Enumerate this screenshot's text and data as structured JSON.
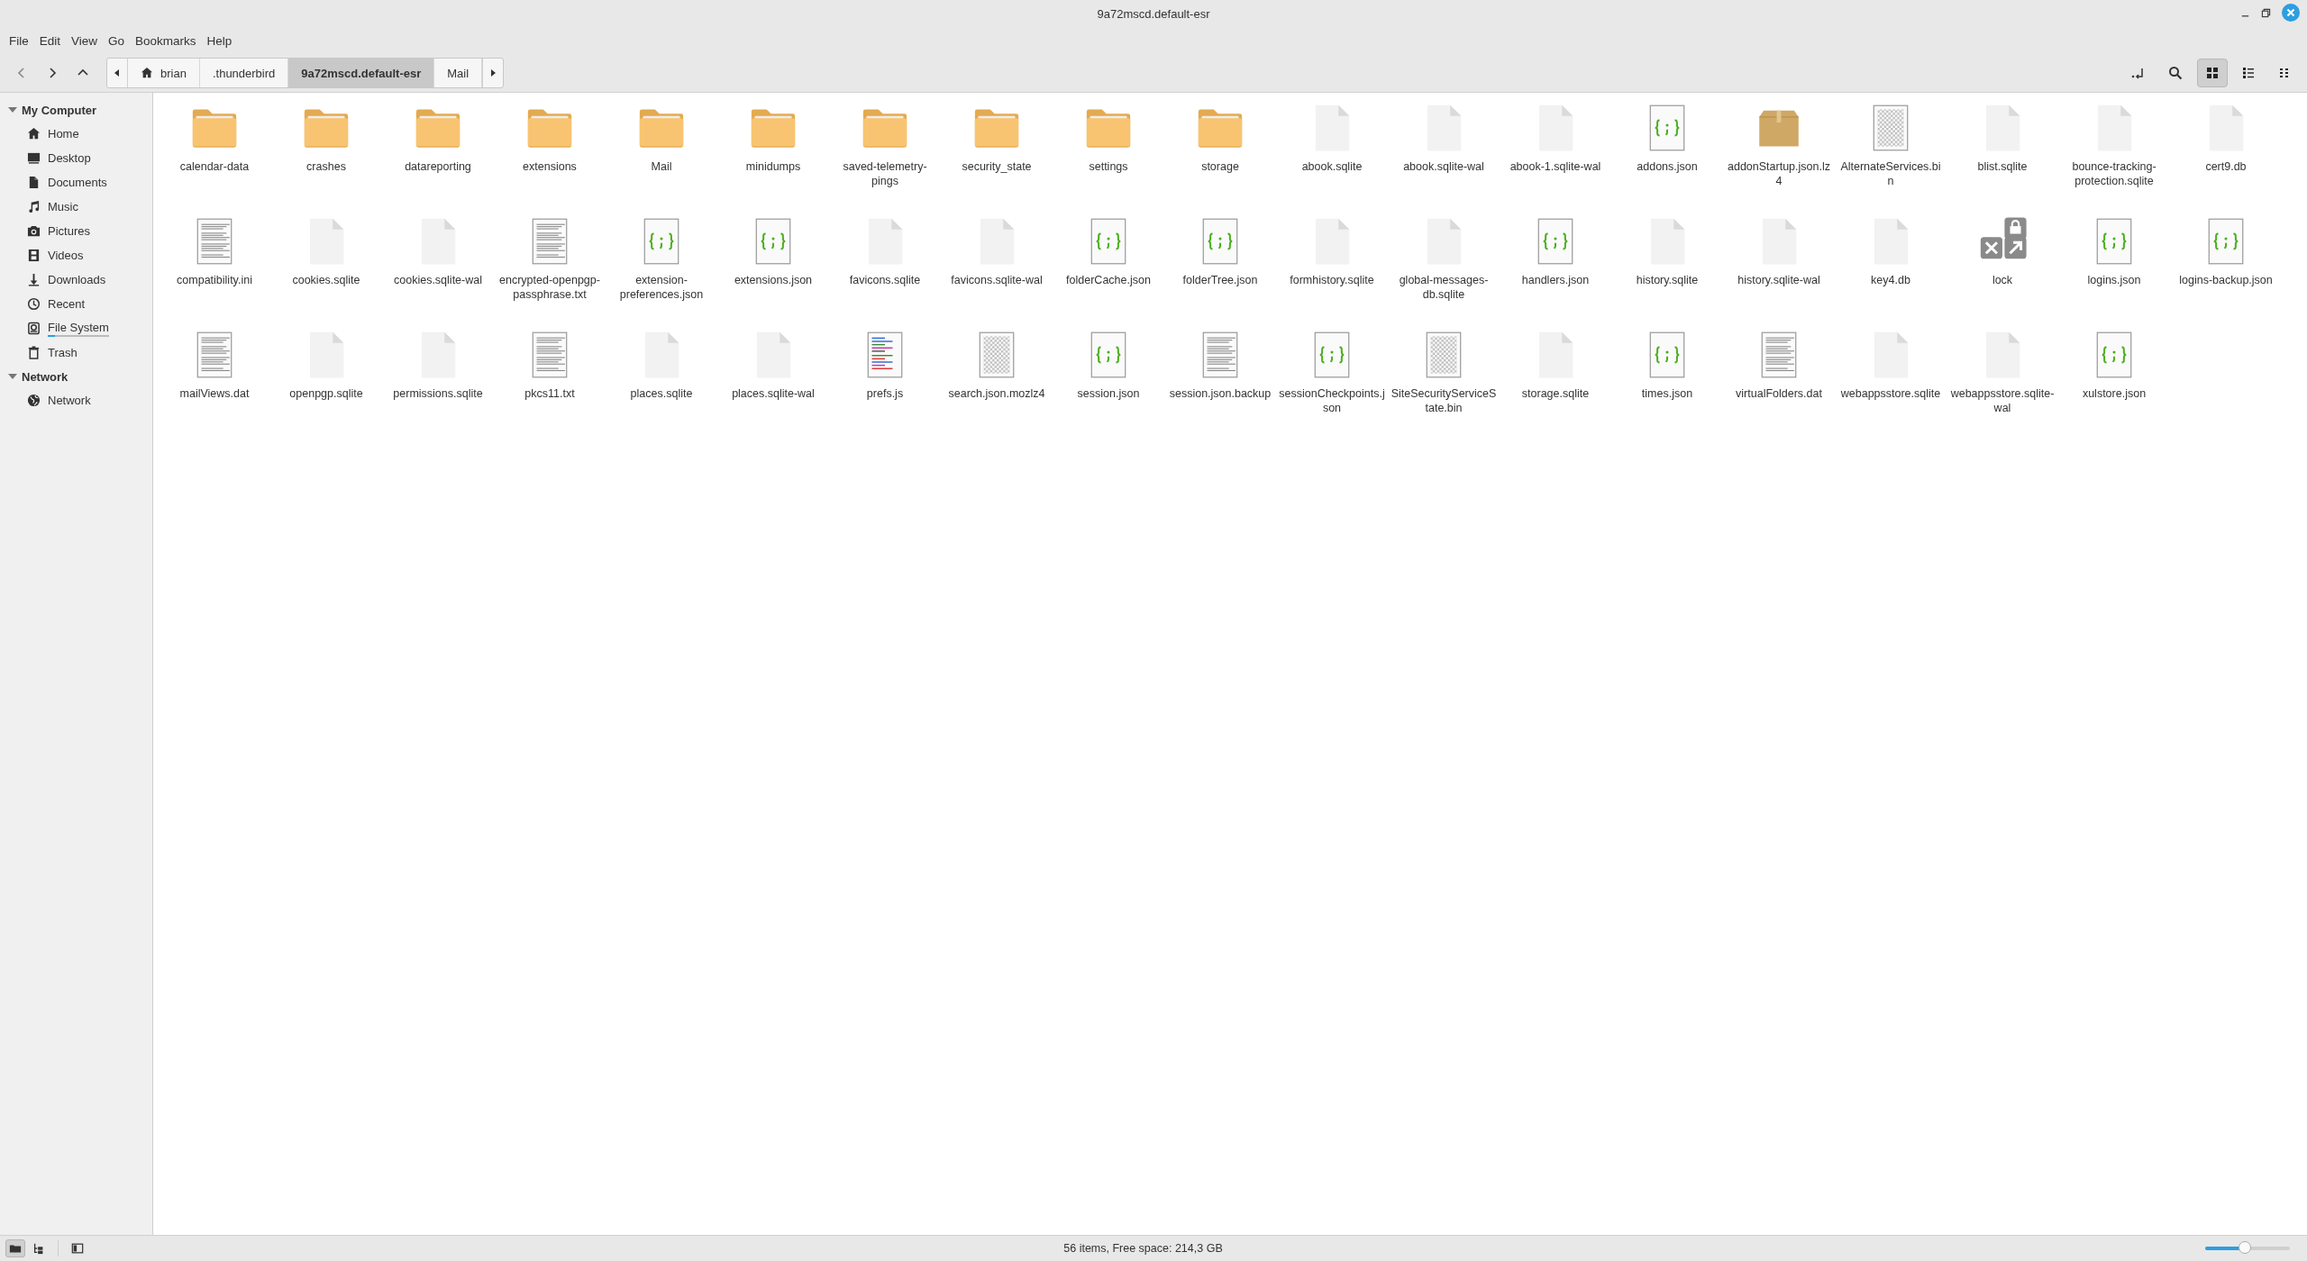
{
  "window": {
    "title": "9a72mscd.default-esr"
  },
  "menu": [
    "File",
    "Edit",
    "View",
    "Go",
    "Bookmarks",
    "Help"
  ],
  "breadcrumbs": [
    {
      "label": "brian",
      "kind": "home",
      "selected": false
    },
    {
      "label": ".thunderbird",
      "kind": "folder",
      "selected": false
    },
    {
      "label": "9a72mscd.default-esr",
      "kind": "folder",
      "selected": true
    },
    {
      "label": "Mail",
      "kind": "folder",
      "selected": false
    }
  ],
  "view_modes": [
    {
      "kind": "icons",
      "selected": true
    },
    {
      "kind": "list",
      "selected": false
    },
    {
      "kind": "compact",
      "selected": false
    }
  ],
  "sidebar": {
    "sections": [
      {
        "label": "My Computer",
        "expanded": true,
        "items": [
          {
            "label": "Home",
            "kind": "home"
          },
          {
            "label": "Desktop",
            "kind": "desktop"
          },
          {
            "label": "Documents",
            "kind": "documents"
          },
          {
            "label": "Music",
            "kind": "music"
          },
          {
            "label": "Pictures",
            "kind": "pictures"
          },
          {
            "label": "Videos",
            "kind": "videos"
          },
          {
            "label": "Downloads",
            "kind": "downloads"
          },
          {
            "label": "Recent",
            "kind": "recent"
          },
          {
            "label": "File System",
            "kind": "filesystem",
            "level": 0.12
          },
          {
            "label": "Trash",
            "kind": "trash"
          }
        ]
      },
      {
        "label": "Network",
        "expanded": true,
        "items": [
          {
            "label": "Network",
            "kind": "network"
          }
        ]
      }
    ]
  },
  "files": [
    {
      "name": "calendar-data",
      "kind": "folder"
    },
    {
      "name": "crashes",
      "kind": "folder"
    },
    {
      "name": "datareporting",
      "kind": "folder"
    },
    {
      "name": "extensions",
      "kind": "folder"
    },
    {
      "name": "Mail",
      "kind": "folder"
    },
    {
      "name": "minidumps",
      "kind": "folder"
    },
    {
      "name": "saved-telemetry-pings",
      "kind": "folder"
    },
    {
      "name": "security_state",
      "kind": "folder"
    },
    {
      "name": "settings",
      "kind": "folder"
    },
    {
      "name": "storage",
      "kind": "folder"
    },
    {
      "name": "abook.sqlite",
      "kind": "blank"
    },
    {
      "name": "abook.sqlite-wal",
      "kind": "blank"
    },
    {
      "name": "abook-1.sqlite-wal",
      "kind": "blank"
    },
    {
      "name": "addons.json",
      "kind": "json"
    },
    {
      "name": "addonStartup.json.lz4",
      "kind": "archive"
    },
    {
      "name": "AlternateServices.bin",
      "kind": "binary"
    },
    {
      "name": "blist.sqlite",
      "kind": "blank"
    },
    {
      "name": "bounce-tracking-protection.sqlite",
      "kind": "blank"
    },
    {
      "name": "cert9.db",
      "kind": "blank"
    },
    {
      "name": "compatibility.ini",
      "kind": "text"
    },
    {
      "name": "cookies.sqlite",
      "kind": "blank"
    },
    {
      "name": "cookies.sqlite-wal",
      "kind": "blank"
    },
    {
      "name": "encrypted-openpgp-passphrase.txt",
      "kind": "text"
    },
    {
      "name": "extension-preferences.json",
      "kind": "json"
    },
    {
      "name": "extensions.json",
      "kind": "json"
    },
    {
      "name": "favicons.sqlite",
      "kind": "blank"
    },
    {
      "name": "favicons.sqlite-wal",
      "kind": "blank"
    },
    {
      "name": "folderCache.json",
      "kind": "json"
    },
    {
      "name": "folderTree.json",
      "kind": "json"
    },
    {
      "name": "formhistory.sqlite",
      "kind": "blank"
    },
    {
      "name": "global-messages-db.sqlite",
      "kind": "blank"
    },
    {
      "name": "handlers.json",
      "kind": "json"
    },
    {
      "name": "history.sqlite",
      "kind": "blank"
    },
    {
      "name": "history.sqlite-wal",
      "kind": "blank"
    },
    {
      "name": "key4.db",
      "kind": "blank"
    },
    {
      "name": "lock",
      "kind": "link"
    },
    {
      "name": "logins.json",
      "kind": "json"
    },
    {
      "name": "logins-backup.json",
      "kind": "json"
    },
    {
      "name": "mailViews.dat",
      "kind": "text"
    },
    {
      "name": "openpgp.sqlite",
      "kind": "blank"
    },
    {
      "name": "permissions.sqlite",
      "kind": "blank"
    },
    {
      "name": "pkcs11.txt",
      "kind": "text"
    },
    {
      "name": "places.sqlite",
      "kind": "blank"
    },
    {
      "name": "places.sqlite-wal",
      "kind": "blank"
    },
    {
      "name": "prefs.js",
      "kind": "script"
    },
    {
      "name": "search.json.mozlz4",
      "kind": "binary"
    },
    {
      "name": "session.json",
      "kind": "json"
    },
    {
      "name": "session.json.backup",
      "kind": "text"
    },
    {
      "name": "sessionCheckpoints.json",
      "kind": "json"
    },
    {
      "name": "SiteSecurityServiceState.bin",
      "kind": "binary"
    },
    {
      "name": "storage.sqlite",
      "kind": "blank"
    },
    {
      "name": "times.json",
      "kind": "json"
    },
    {
      "name": "virtualFolders.dat",
      "kind": "text"
    },
    {
      "name": "webappsstore.sqlite",
      "kind": "blank"
    },
    {
      "name": "webappsstore.sqlite-wal",
      "kind": "blank"
    },
    {
      "name": "xulstore.json",
      "kind": "json"
    }
  ],
  "bottom_buttons": [
    {
      "kind": "places",
      "selected": true
    },
    {
      "kind": "tree",
      "selected": false
    },
    {
      "kind": "sidebar",
      "selected": false
    }
  ],
  "status_bar": {
    "text": "56 items, Free space: 214,3 GB",
    "zoom": {
      "level": 0.47
    }
  }
}
